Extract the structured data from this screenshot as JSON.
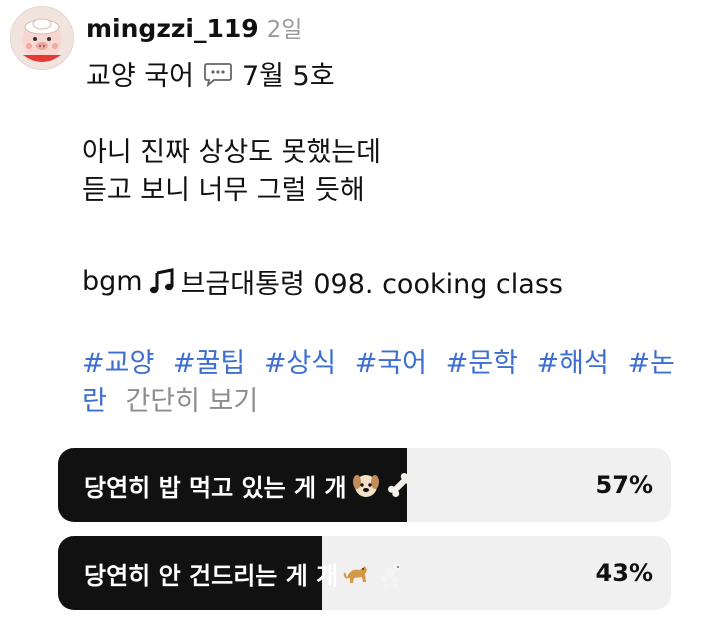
{
  "post": {
    "username": "mingzzi_119",
    "time": "2일",
    "subtitle_before": "교양 국어",
    "subtitle_after": "7월 5호",
    "body_lines": [
      "아니 진짜 상상도 못했는데",
      "듣고 보니 너무 그럴 듯해"
    ],
    "bgm_prefix": "bgm",
    "bgm_text": "브금대통령 098. cooking class",
    "tags": [
      "#교양",
      "#꿀팁",
      "#상식",
      "#국어",
      "#문학",
      "#해석",
      "#논란"
    ],
    "more_label": "간단히 보기"
  },
  "poll": {
    "options": [
      {
        "label": "당연히 밥 먹고 있는 게 개",
        "percent_text": "57%",
        "percent": 57
      },
      {
        "label": "당연히 안 건드리는 게 개",
        "percent_text": "43%",
        "percent": 43
      }
    ]
  },
  "icons": {
    "avatar": "pig-avatar-icon",
    "speech": "speech-bubble-icon",
    "music": "music-note-icon",
    "dog_face": "dog-face-icon",
    "bone": "bone-icon",
    "dog": "dog-icon",
    "poodle": "poodle-icon"
  },
  "colors": {
    "tag": "#3c6fd1",
    "poll_fill": "#111111",
    "poll_bg": "#f0f0f0",
    "muted": "#8d8d8d"
  }
}
